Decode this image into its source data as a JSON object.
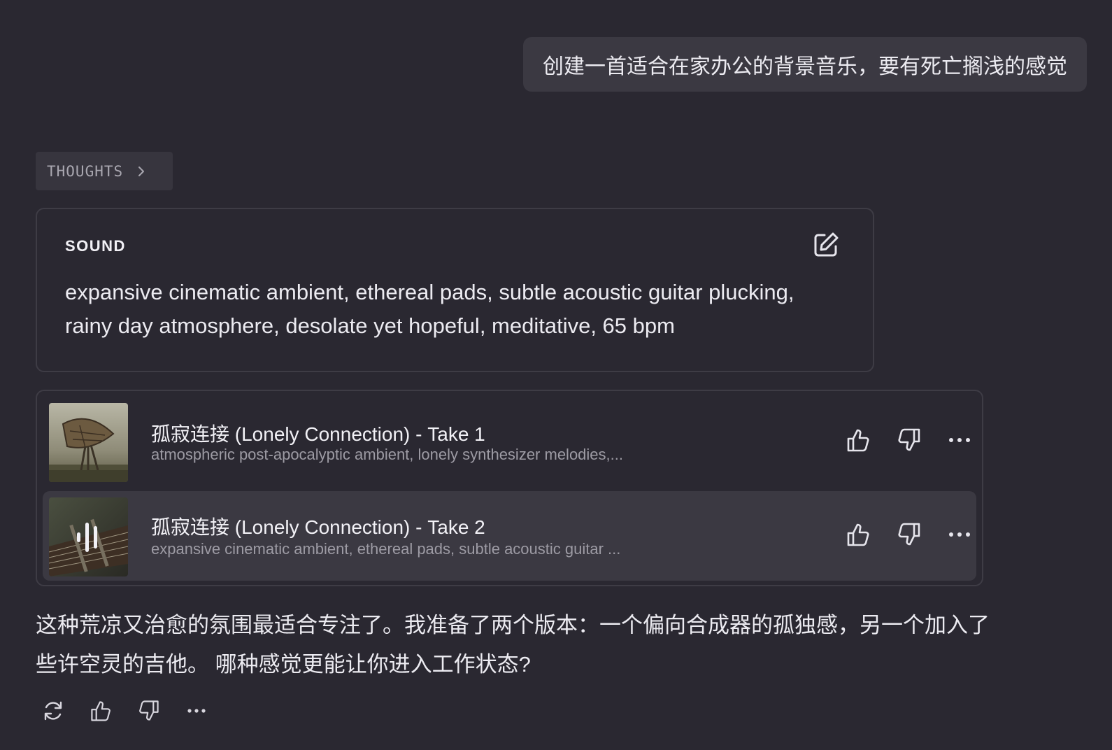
{
  "user_message": {
    "text": "创建一首适合在家办公的背景音乐，要有死亡搁浅的感觉"
  },
  "thoughts": {
    "label": "THOUGHTS",
    "icon": "chevron-right-icon"
  },
  "sound_card": {
    "title": "SOUND",
    "edit_icon": "edit-icon",
    "description": "expansive cinematic ambient, ethereal pads, subtle acoustic guitar plucking, rainy day atmosphere, desolate yet hopeful, meditative, 65 bpm"
  },
  "tracks": [
    {
      "title": "孤寂连接 (Lonely Connection) - Take 1",
      "subtitle": "atmospheric post-apocalyptic ambient, lonely synthesizer melodies,...",
      "cover": "radar-dish-artwork",
      "playing": false
    },
    {
      "title": "孤寂连接 (Lonely Connection) - Take 2",
      "subtitle": "expansive cinematic ambient, ethereal pads, subtle acoustic guitar ...",
      "cover": "guitar-strings-artwork",
      "playing": true,
      "playing_icon": "audio-bars-icon"
    }
  ],
  "reply": {
    "text": "这种荒凉又治愈的氛围最适合专注了。我准备了两个版本：一个偏向合成器的孤独感，另一个加入了些许空灵的吉他。 哪种感觉更能让你进入工作状态?"
  },
  "actions": {
    "icons": [
      "regenerate-icon",
      "thumbs-up-icon",
      "thumbs-down-icon",
      "more-icon"
    ]
  },
  "colors": {
    "background": "#2a2831",
    "bubble": "#3b3942",
    "border": "#3e3c45",
    "text": "#ecebf1",
    "muted": "#9d9ba4"
  }
}
